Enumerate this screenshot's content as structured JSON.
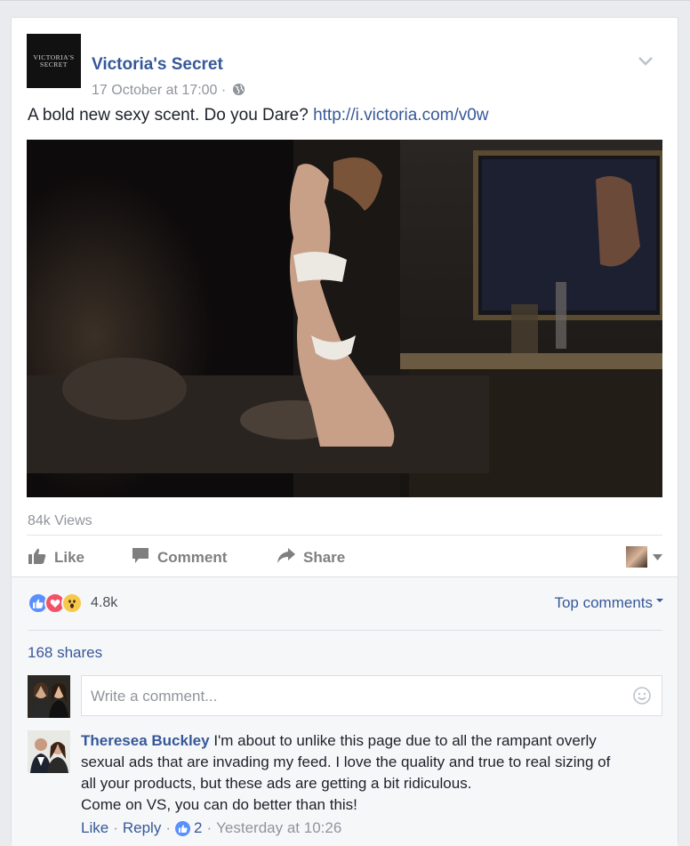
{
  "post": {
    "page_name": "Victoria's Secret",
    "logo_line1": "VICTORIA'S",
    "logo_line2": "SECRET",
    "timestamp": "17 October at 17:00",
    "meta_sep": "·",
    "privacy_icon": "globe-icon",
    "options_icon": "chevron-down-icon",
    "text": "A bold new sexy scent. Do you Dare?",
    "link": "http://i.victoria.com/v0w",
    "views": "84k Views"
  },
  "actions": {
    "like": "Like",
    "comment": "Comment",
    "share": "Share"
  },
  "engagement": {
    "reaction_icons": [
      "like-reaction-icon",
      "love-reaction-icon",
      "wow-reaction-icon"
    ],
    "reaction_count": "4.8k",
    "top_comments": "Top comments",
    "shares": "168 shares"
  },
  "composer": {
    "placeholder": "Write a comment..."
  },
  "comment": {
    "author": "Theresea Buckley",
    "lines": [
      "I'm about to unlike this page due to all the rampant overly",
      "sexual ads that are invading my feed. I love the quality and true to real sizing of",
      "all your products, but these ads are getting a bit ridiculous.",
      "Come on VS, you can do better than this!"
    ],
    "like": "Like",
    "reply": "Reply",
    "sep": "·",
    "like_count": "2",
    "time": "Yesterday at 10:26"
  },
  "colors": {
    "link": "#365899",
    "muted": "#90949c",
    "like_blue": "#5890ff",
    "love_red": "#f25268",
    "wow_yellow": "#f7c84b"
  }
}
